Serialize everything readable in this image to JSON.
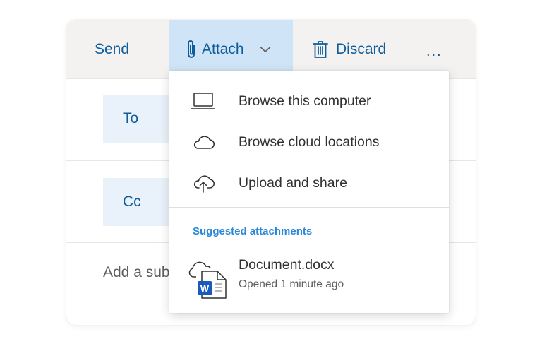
{
  "toolbar": {
    "send_label": "Send",
    "attach_label": "Attach",
    "discard_label": "Discard",
    "more_label": "..."
  },
  "fields": {
    "to_label": "To",
    "cc_label": "Cc",
    "subject_placeholder": "Add a subject"
  },
  "attach_menu": {
    "items": [
      {
        "label": "Browse this computer",
        "icon": "laptop-icon"
      },
      {
        "label": "Browse cloud locations",
        "icon": "cloud-icon"
      },
      {
        "label": "Upload and share",
        "icon": "cloud-upload-icon"
      }
    ],
    "suggested_heading": "Suggested attachments",
    "suggestions": [
      {
        "name": "Document.docx",
        "meta": "Opened 1 minute ago",
        "icon": "word-cloud-document-icon"
      }
    ]
  },
  "colors": {
    "accent": "#0f5c9b",
    "toolbar_bg": "#f3f2f1",
    "attach_highlight": "#cfe4f6",
    "chip_bg": "#e9f1fa",
    "section_heading": "#2b88d8",
    "word_blue": "#185abd"
  }
}
